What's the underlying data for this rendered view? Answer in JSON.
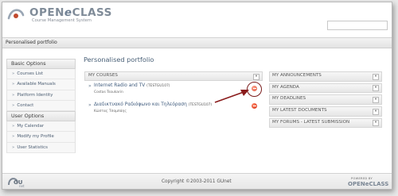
{
  "header": {
    "logo_name": "OPEN",
    "logo_e": "e",
    "logo_name_end": "CLASS",
    "logo_subtitle": "Course Management System",
    "search_placeholder": ""
  },
  "breadcrumb": {
    "current": "Personalised portfolio"
  },
  "sidebar": {
    "sections": [
      {
        "title": "Basic Options",
        "items": [
          {
            "label": "Courses List"
          },
          {
            "label": "Available Manuals"
          },
          {
            "label": "Platform Identity"
          },
          {
            "label": "Contact"
          }
        ]
      },
      {
        "title": "User Options",
        "items": [
          {
            "label": "My Calendar"
          },
          {
            "label": "Modify my Profile"
          },
          {
            "label": "User Statistics"
          }
        ]
      }
    ]
  },
  "main": {
    "title": "Personalised portfolio",
    "courses": {
      "header": "MY COURSES",
      "toggle": "▾",
      "items": [
        {
          "title": "Internet Radio and TV",
          "code": "(TESTGU107)",
          "professor": "Costas Tsoukarin"
        },
        {
          "title": "Διαδικτυακό Ραδιόφωνο και Τηλεόραση",
          "code": "(TESTGU107)",
          "professor": "Κώστας Τσαμπάης"
        }
      ]
    }
  },
  "panels": [
    {
      "label": "MY ANNOUNCEMENTS",
      "toggle": "▾"
    },
    {
      "label": "MY AGENDA",
      "toggle": "▾"
    },
    {
      "label": "MY DEADLINES",
      "toggle": "▾"
    },
    {
      "label": "MY LATEST DOCUMENTS",
      "toggle": "▾"
    },
    {
      "label": "MY FORUMS - LATEST SUBMISSION",
      "toggle": "▾"
    }
  ],
  "footer": {
    "logo_text": "GU",
    "logo_sub": "net",
    "copyright": "Copyright ©2003-2011 GUnet",
    "powered_by": "POWERED BY",
    "powered_logo": "OPENeCLASS"
  },
  "colors": {
    "accent": "#4a6178",
    "link": "#3e5a7c",
    "unregister": "#d42a10",
    "highlight": "#7a1d1d"
  },
  "icons": {
    "logo": "openeclass-logo-icon",
    "unregister": "unregister-icon",
    "toggle": "chevron-down-icon",
    "pointer": "arrow-pointer-icon"
  }
}
